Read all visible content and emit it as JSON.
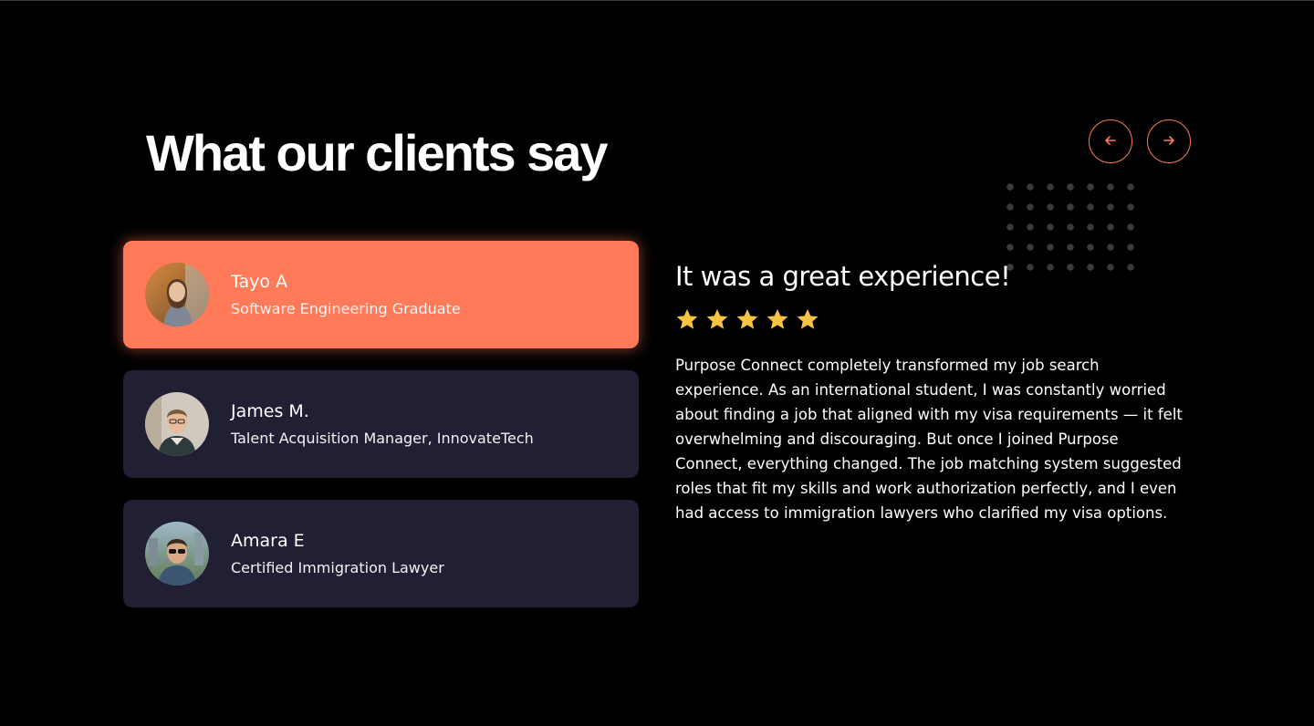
{
  "section": {
    "heading": "What our clients say"
  },
  "navigation": {
    "prev_icon": "arrow-left-icon",
    "next_icon": "arrow-right-icon",
    "accent_color": "#ff7a59"
  },
  "clients": [
    {
      "name": "Tayo A",
      "role": "Software Engineering Graduate",
      "active": true
    },
    {
      "name": "James M.",
      "role": "Talent Acquisition Manager, InnovateTech",
      "active": false
    },
    {
      "name": "Amara E",
      "role": "Certified Immigration Lawyer",
      "active": false
    }
  ],
  "testimonial": {
    "title": "It was a great experience!",
    "rating": 5,
    "rating_max": 5,
    "body": "Purpose Connect completely transformed my job search experience. As an international student, I was constantly worried about finding a job that aligned with my visa requirements — it felt overwhelming and discouraging. But once I joined Purpose Connect, everything changed. The job matching system suggested roles that fit my skills and work authorization perfectly, and I even had access to immigration lawyers who clarified my visa options."
  },
  "colors": {
    "background": "#000000",
    "card": "#201f33",
    "card_active": "#ff7a59",
    "star": "#f6c342"
  }
}
